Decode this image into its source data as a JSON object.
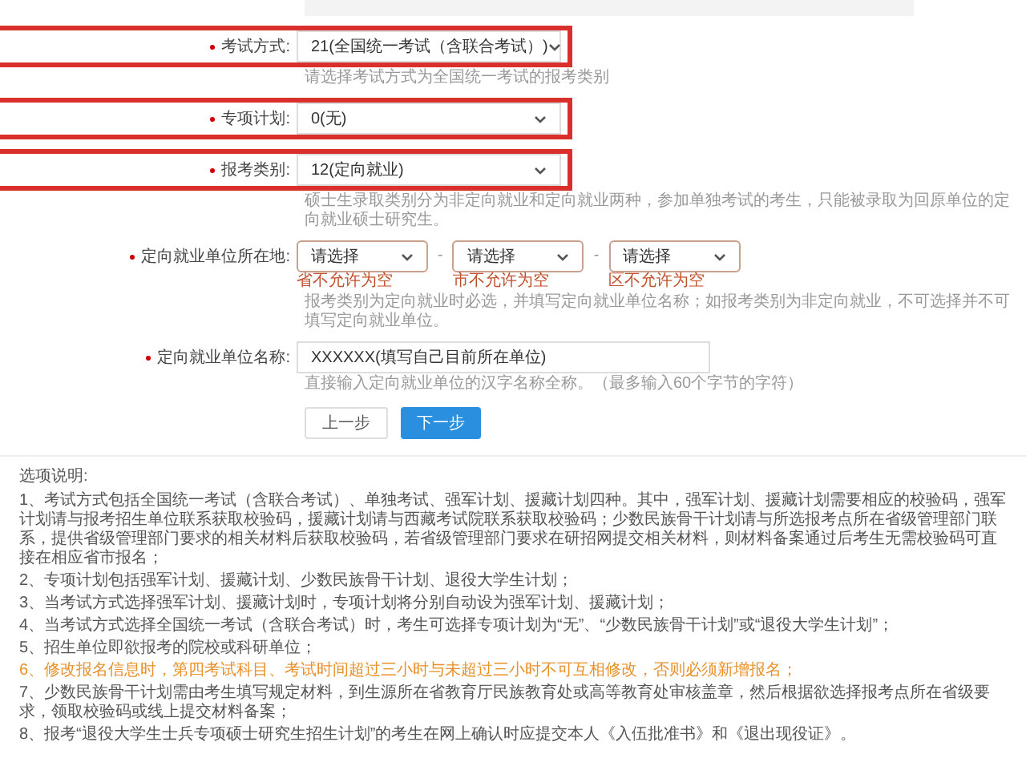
{
  "form": {
    "fields": [
      {
        "kind": "select",
        "label": "考试方式:",
        "required": true,
        "value": "21(全国统一考试（含联合考试）)",
        "highlighted": true,
        "hint": "请选择考试方式为全国统一考试的报考类别"
      },
      {
        "kind": "select",
        "label": "专项计划:",
        "required": true,
        "value": "0(无)",
        "highlighted": true
      },
      {
        "kind": "select",
        "label": "报考类别:",
        "required": true,
        "value": "12(定向就业)",
        "highlighted": true,
        "hint": "硕士生录取类别分为非定向就业和定向就业两种，参加单独考试的考生，只能被录取为回原单位的定向就业硕士研究生。"
      },
      {
        "kind": "region",
        "label": "定向就业单位所在地:",
        "required": true,
        "selects": [
          {
            "placeholder": "请选择",
            "error": "省不允许为空"
          },
          {
            "placeholder": "请选择",
            "error": "市不允许为空"
          },
          {
            "placeholder": "请选择",
            "error": "区不允许为空"
          }
        ],
        "separator": "-",
        "hint": "报考类别为定向就业时必选，并填写定向就业单位名称；如报考类别为非定向就业，不可选择并不可填写定向就业单位。"
      },
      {
        "kind": "text",
        "label": "定向就业单位名称:",
        "required": true,
        "value": "XXXXXX(填写自己目前所在单位)",
        "hint": "直接输入定向就业单位的汉字名称全称。（最多输入60个字节的字符）"
      }
    ],
    "buttons": [
      {
        "label": "上一步",
        "primary": false
      },
      {
        "label": "下一步",
        "primary": true
      }
    ]
  },
  "notes": {
    "title": "选项说明:",
    "items": [
      {
        "text": "1、考试方式包括全国统一考试（含联合考试）、单独考试、强军计划、援藏计划四种。其中，强军计划、援藏计划需要相应的校验码，强军计划请与报考招生单位联系获取校验码，援藏计划请与西藏考试院联系获取校验码；少数民族骨干计划请与所选报考点所在省级管理部门联系，提供省级管理部门要求的相关材料后获取校验码，若省级管理部门要求在研招网提交相关材料，则材料备案通过后考生无需校验码可直接在相应省市报名；",
        "warning": false
      },
      {
        "text": "2、专项计划包括强军计划、援藏计划、少数民族骨干计划、退役大学生计划；",
        "warning": false
      },
      {
        "text": "3、当考试方式选择强军计划、援藏计划时，专项计划将分别自动设为强军计划、援藏计划；",
        "warning": false
      },
      {
        "text": "4、当考试方式选择全国统一考试（含联合考试）时，考生可选择专项计划为“无”、“少数民族骨干计划”或“退役大学生计划”；",
        "warning": false
      },
      {
        "text": "5、招生单位即欲报考的院校或科研单位；",
        "warning": false
      },
      {
        "text": "6、修改报名信息时，第四考试科目、考试时间超过三小时与未超过三小时不可互相修改，否则必须新增报名；",
        "warning": true
      },
      {
        "text": "7、少数民族骨干计划需由考生填写规定材料，到生源所在省教育厅民族教育处或高等教育处审核盖章，然后根据欲选择报考点所在省级要求，领取校验码或线上提交材料备案；",
        "warning": false
      },
      {
        "text": "8、报考“退役大学生士兵专项硕士研究生招生计划”的考生在网上确认时应提交本人《入伍批准书》和《退出现役证》。",
        "warning": false
      }
    ]
  }
}
